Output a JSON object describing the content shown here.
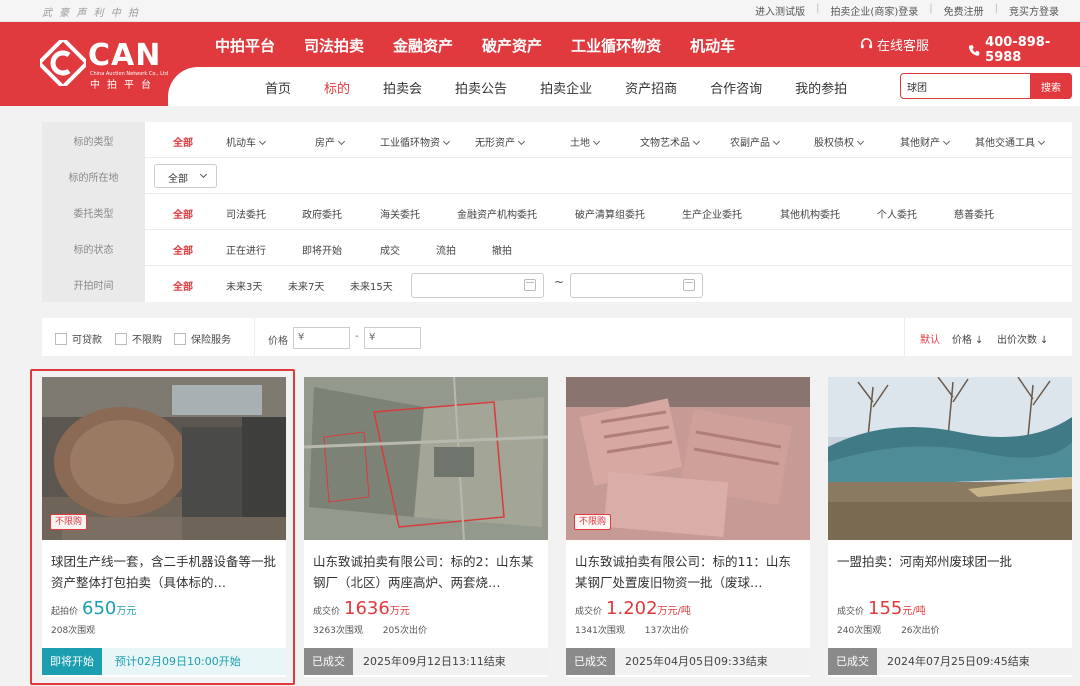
{
  "utility": {
    "slogan": "武 豪 声 利 中 拍",
    "links": [
      "进入测试版",
      "拍卖企业(商家)登录",
      "免费注册",
      "竞买方登录"
    ]
  },
  "logo": {
    "word": "CAN",
    "tagline": "China Auction Network Co., Ltd",
    "cn": "中拍平台"
  },
  "mainnav": [
    "中拍平台",
    "司法拍卖",
    "金融资产",
    "破产资产",
    "工业循环物资",
    "机动车"
  ],
  "service": {
    "label": "在线客服",
    "icon": "headset-icon"
  },
  "phone": {
    "number": "400-898-5988",
    "icon": "phone-icon"
  },
  "subnav": [
    {
      "label": "首页",
      "active": false
    },
    {
      "label": "标的",
      "active": true
    },
    {
      "label": "拍卖会",
      "active": false
    },
    {
      "label": "拍卖公告",
      "active": false
    },
    {
      "label": "拍卖企业",
      "active": false
    },
    {
      "label": "资产招商",
      "active": false
    },
    {
      "label": "合作咨询",
      "active": false
    },
    {
      "label": "我的参拍",
      "active": false
    }
  ],
  "search": {
    "value": "球团",
    "button": "搜索"
  },
  "filters": {
    "type": {
      "label": "标的类型",
      "options": [
        "全部",
        "机动车",
        "房产",
        "工业循环物资",
        "无形资产",
        "土地",
        "文物艺术品",
        "农副产品",
        "股权债权",
        "其他财产",
        "其他交通工具"
      ]
    },
    "location": {
      "label": "标的所在地",
      "selected": "全部"
    },
    "entrust": {
      "label": "委托类型",
      "options": [
        "全部",
        "司法委托",
        "政府委托",
        "海关委托",
        "金融资产机构委托",
        "破产清算组委托",
        "生产企业委托",
        "其他机构委托",
        "个人委托",
        "慈善委托"
      ]
    },
    "status": {
      "label": "标的状态",
      "options": [
        "全部",
        "正在进行",
        "即将开始",
        "成交",
        "流拍",
        "撤拍"
      ]
    },
    "time": {
      "label": "开拍时间",
      "options": [
        "全部",
        "未来3天",
        "未来7天",
        "未来15天"
      ],
      "separator": "~"
    }
  },
  "sortbar": {
    "checks": [
      "可贷款",
      "不限购",
      "保险服务"
    ],
    "price_label": "价格",
    "price_min_placeholder": "¥",
    "price_max_placeholder": "¥",
    "price_sep": "-",
    "sorts": [
      {
        "label": "默认",
        "active": true
      },
      {
        "label": "价格",
        "arrow": "↓",
        "active": false
      },
      {
        "label": "出价次数",
        "arrow": "↓",
        "active": false
      }
    ]
  },
  "cards": [
    {
      "badge": "不限购",
      "title": "球团生产线一套，含二手机器设备等一批资产整体打包拍卖（具体标的…",
      "price_label": "起拍价",
      "price": "650",
      "unit": "万元",
      "views": "208次围观",
      "bids": "",
      "status": "即将开始",
      "footer": "预计02月09日10:00开始"
    },
    {
      "badge": "",
      "title": "山东致诚拍卖有限公司：标的2：山东某钢厂（北区）两座高炉、两套烧…",
      "price_label": "成交价",
      "price": "1636",
      "unit": "万元",
      "views": "3263次围观",
      "bids": "205次出价",
      "status": "已成交",
      "footer": "2025年09月12日13:11结束"
    },
    {
      "badge": "不限购",
      "title": "山东致诚拍卖有限公司：标的11：山东某钢厂处置废旧物资一批（废球…",
      "price_label": "成交价",
      "price": "1.202",
      "unit": "万元/吨",
      "views": "1341次围观",
      "bids": "137次出价",
      "status": "已成交",
      "footer": "2025年04月05日09:33结束"
    },
    {
      "badge": "",
      "title": "一盟拍卖：河南郑州废球团一批",
      "price_label": "成交价",
      "price": "155",
      "unit": "元/吨",
      "views": "240次围观",
      "bids": "26次出价",
      "status": "已成交",
      "footer": "2024年07月25日09:45结束"
    }
  ],
  "colors": {
    "brand": "#e03a3e",
    "soon": "#1b9fb0",
    "done": "#8a8a8a"
  }
}
